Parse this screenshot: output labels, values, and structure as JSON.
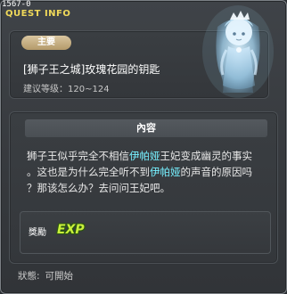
{
  "window": {
    "quest_id": "1567-0",
    "title": "QUEST INFO"
  },
  "quest": {
    "category": "主要",
    "name": "[狮子王之城]玫瑰花园的钥匙",
    "level_req": "建议等级：120~124"
  },
  "content": {
    "header": "內容",
    "line1_a": "狮子王似乎完全不相信",
    "line1_hl": "伊帕娅",
    "line1_b": "王妃变成幽灵的事实",
    "line2_a": "。这也是为什么完全听不到",
    "line2_hl": "伊帕娅",
    "line2_b": "的声音的原因吗",
    "line3": "？那该怎么办？去问问王妃吧。"
  },
  "reward": {
    "label": "獎勵",
    "exp_label": "EXP"
  },
  "status": {
    "label": "狀態:",
    "value": "可開始"
  },
  "colors": {
    "title": "#f0d95a",
    "highlight": "#76f0ff",
    "badge": "#c4ab7d"
  },
  "icons": {
    "npc": "ghost-queen-portrait",
    "exp": "exp-icon"
  }
}
